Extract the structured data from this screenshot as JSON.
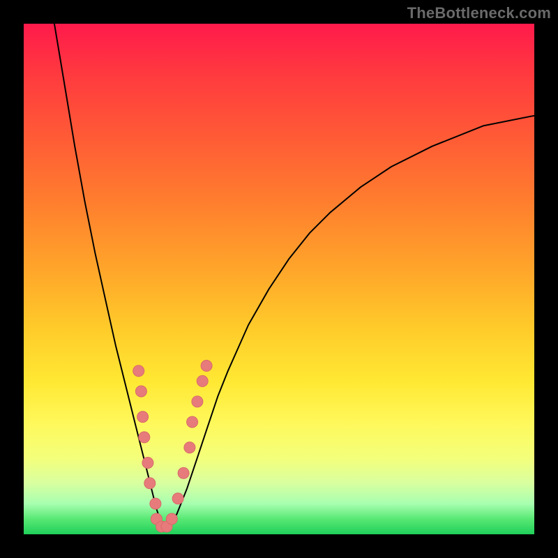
{
  "watermark": {
    "text": "TheBottleneck.com"
  },
  "colors": {
    "curve_stroke": "#000000",
    "marker_fill": "#e77b7b",
    "marker_stroke": "#d86a6a",
    "frame_bg": "#000000"
  },
  "chart_data": {
    "type": "line",
    "title": "",
    "xlabel": "",
    "ylabel": "",
    "xlim": [
      0,
      100
    ],
    "ylim": [
      0,
      100
    ],
    "notes": "V-shaped bottleneck curve with scattered sample points near the valley. x is the relative component scale (0–100); y is the bottleneck percentage (0–100). Minimum ≈ x=27, y≈0.",
    "curve": {
      "x": [
        6,
        8,
        10,
        12,
        14,
        16,
        18,
        20,
        22,
        24,
        25,
        26,
        27,
        28,
        29,
        30,
        32,
        34,
        36,
        38,
        40,
        44,
        48,
        52,
        56,
        60,
        66,
        72,
        80,
        90,
        100
      ],
      "y": [
        100,
        88,
        76,
        65,
        55,
        46,
        37,
        29,
        21,
        13,
        9,
        5,
        2,
        1,
        2,
        4,
        9,
        15,
        21,
        27,
        32,
        41,
        48,
        54,
        59,
        63,
        68,
        72,
        76,
        80,
        82
      ]
    },
    "series": [
      {
        "name": "samples",
        "type": "scatter",
        "points": [
          {
            "x": 22.5,
            "y": 32
          },
          {
            "x": 23.0,
            "y": 28
          },
          {
            "x": 23.3,
            "y": 23
          },
          {
            "x": 23.6,
            "y": 19
          },
          {
            "x": 24.3,
            "y": 14
          },
          {
            "x": 24.7,
            "y": 10
          },
          {
            "x": 25.8,
            "y": 6
          },
          {
            "x": 26.0,
            "y": 3
          },
          {
            "x": 27.0,
            "y": 1.5
          },
          {
            "x": 28.0,
            "y": 1.5
          },
          {
            "x": 29.0,
            "y": 3
          },
          {
            "x": 30.2,
            "y": 7
          },
          {
            "x": 31.3,
            "y": 12
          },
          {
            "x": 32.5,
            "y": 17
          },
          {
            "x": 33.0,
            "y": 22
          },
          {
            "x": 34.0,
            "y": 26
          },
          {
            "x": 35.0,
            "y": 30
          },
          {
            "x": 35.8,
            "y": 33
          }
        ]
      }
    ]
  }
}
